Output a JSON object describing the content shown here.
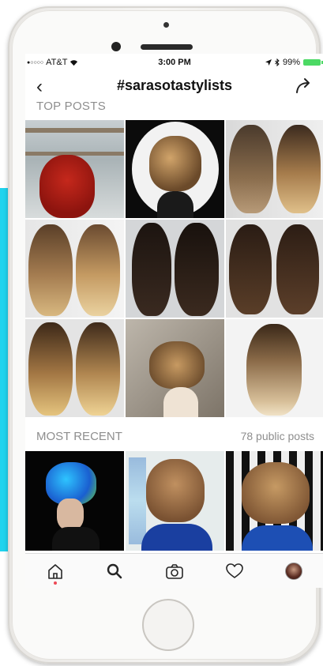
{
  "status": {
    "carrier": "AT&T",
    "time": "3:00 PM",
    "battery": "99%",
    "signal_icon": "signal-dots-icon",
    "wifi_icon": "wifi-icon",
    "location_icon": "location-arrow-icon",
    "bluetooth_icon": "bluetooth-icon"
  },
  "nav": {
    "title": "#sarasotastylists",
    "back_glyph": "‹"
  },
  "sections": {
    "top_posts": "TOP POSTS",
    "most_recent": "MOST RECENT",
    "public_posts": "78 public posts"
  },
  "tabs": [
    {
      "name": "home",
      "icon": "home-icon",
      "active": true
    },
    {
      "name": "search",
      "icon": "search-icon"
    },
    {
      "name": "camera",
      "icon": "camera-icon"
    },
    {
      "name": "activity",
      "icon": "heart-icon"
    },
    {
      "name": "profile",
      "icon": "avatar-icon"
    }
  ],
  "colors": {
    "accent_cyan": "#1fd3ee",
    "battery_green": "#4cd964",
    "notification_red": "#ed4956",
    "secondary_text": "#8e8e8e"
  }
}
